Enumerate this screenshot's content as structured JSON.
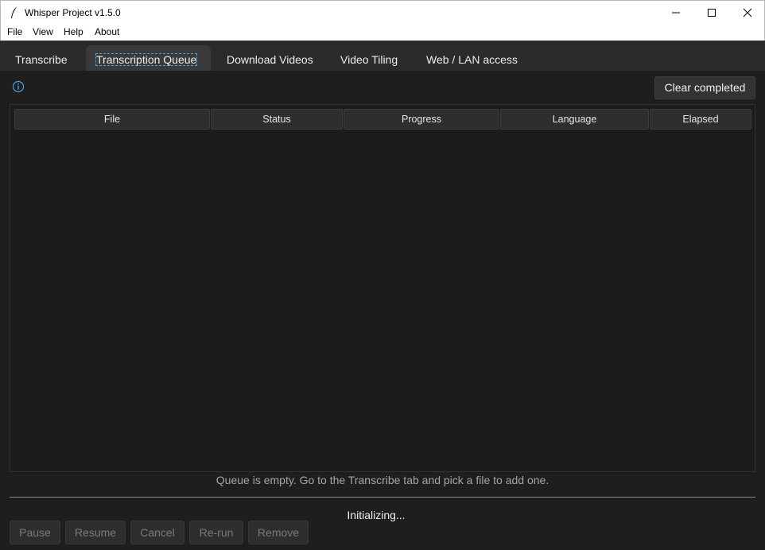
{
  "window": {
    "title": "Whisper Project v1.5.0",
    "app_icon": "feather-icon",
    "controls": [
      "minimize-icon",
      "maximize-icon",
      "close-icon"
    ]
  },
  "menu": [
    "File",
    "View",
    "Help",
    "About"
  ],
  "tabs": [
    {
      "label": "Transcribe",
      "active": false
    },
    {
      "label": "Transcription Queue",
      "active": true
    },
    {
      "label": "Download Videos",
      "active": false
    },
    {
      "label": "Video Tiling",
      "active": false
    },
    {
      "label": "Web / LAN access",
      "active": false
    }
  ],
  "queue": {
    "info_icon": "info-icon",
    "clear_label": "Clear completed",
    "columns": [
      "File",
      "Status",
      "Progress",
      "Language",
      "Elapsed"
    ],
    "rows": [],
    "empty_message": "Queue is empty.  Go to the Transcribe tab and pick a file to add one.",
    "status": "Initializing...",
    "actions": [
      "Pause",
      "Resume",
      "Cancel",
      "Re-run",
      "Remove"
    ]
  },
  "colors": {
    "background": "#1e1e1e",
    "tabbar": "#2b2b2b",
    "active_tab": "#3a3a3a",
    "accent": "#4f9fd6",
    "disabled_text": "#7a7a7a"
  }
}
